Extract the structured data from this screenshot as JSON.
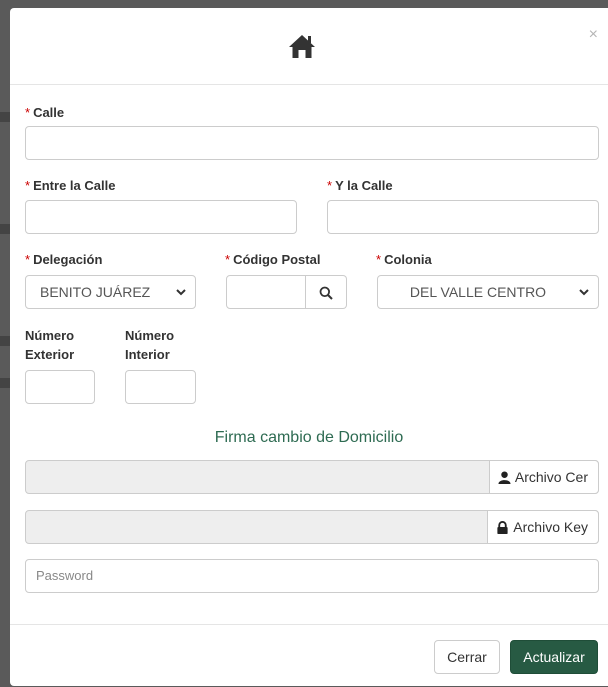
{
  "modal": {
    "close_label": "×"
  },
  "form": {
    "required_mark": "*",
    "calle_label": "Calle",
    "entre_calle_label": "Entre la Calle",
    "y_calle_label": "Y la Calle",
    "delegacion_label": "Delegación",
    "delegacion_value": "BENITO JUÁREZ",
    "codigo_postal_label": "Código Postal",
    "colonia_label": "Colonia",
    "colonia_value": "DEL VALLE CENTRO",
    "numero_exterior_label_1": "Número",
    "numero_exterior_label_2": "Exterior",
    "numero_interior_label_1": "Número",
    "numero_interior_label_2": "Interior"
  },
  "firma": {
    "title": "Firma cambio de Domicilio",
    "archivo_cer_label": "Archivo Cer",
    "archivo_key_label": "Archivo Key",
    "password_placeholder": "Password"
  },
  "footer": {
    "cerrar_label": "Cerrar",
    "actualizar_label": "Actualizar"
  },
  "colors": {
    "accent": "#275a43",
    "section_title": "#2e6b52",
    "required": "#cc0000"
  },
  "icons": [
    "home-icon",
    "close-icon",
    "search-icon",
    "user-icon",
    "lock-icon",
    "chevron-down-icon"
  ]
}
